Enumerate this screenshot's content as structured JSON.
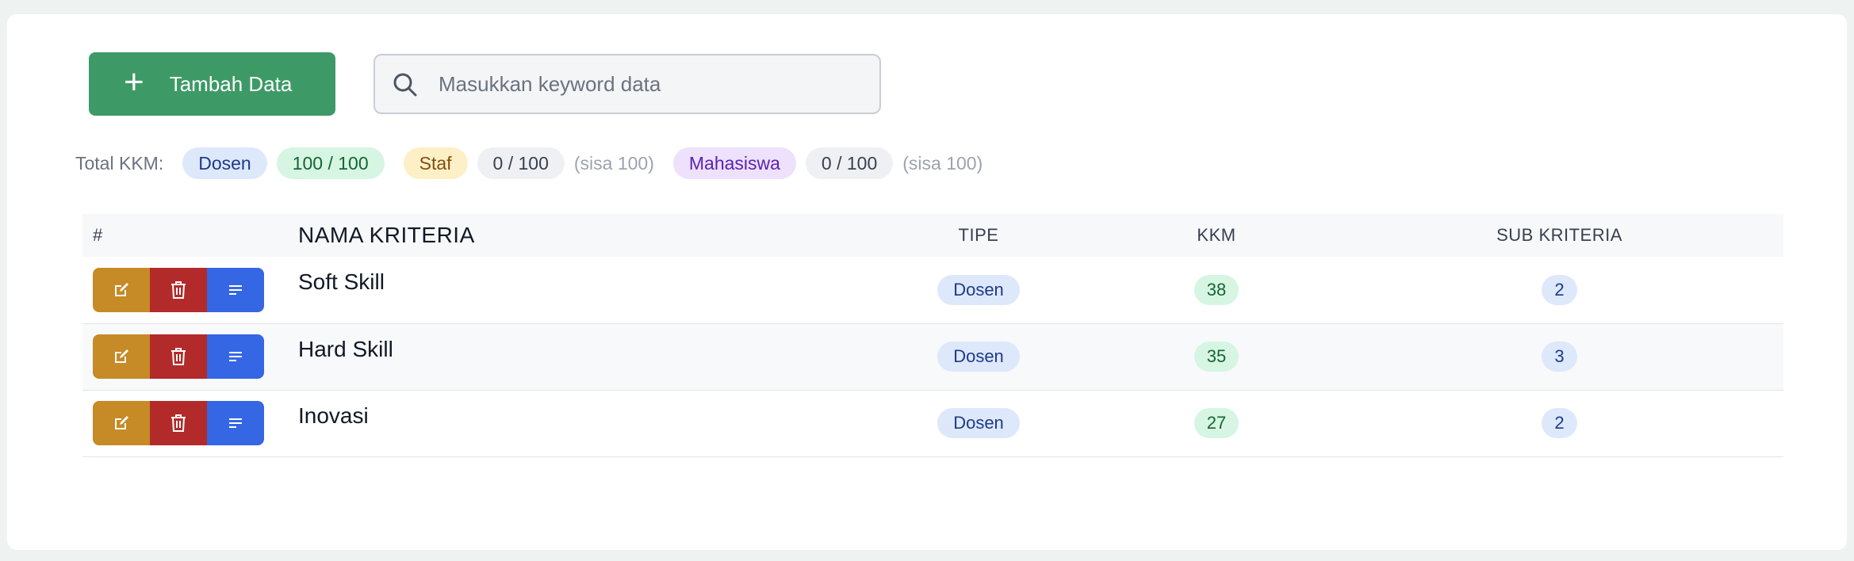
{
  "toolbar": {
    "add_label": "Tambah Data",
    "search_placeholder": "Masukkan keyword data"
  },
  "kkm_summary": {
    "label": "Total KKM:",
    "dosen": {
      "name": "Dosen",
      "value": "100 / 100"
    },
    "staf": {
      "name": "Staf",
      "value": "0 / 100",
      "sisa": "(sisa 100)"
    },
    "mahasiswa": {
      "name": "Mahasiswa",
      "value": "0 / 100",
      "sisa": "(sisa 100)"
    }
  },
  "table": {
    "headers": [
      "#",
      "NAMA KRITERIA",
      "TIPE",
      "KKM",
      "SUB KRITERIA"
    ],
    "rows": [
      {
        "nama": "Soft Skill",
        "tipe": "Dosen",
        "kkm": "38",
        "sub": "2"
      },
      {
        "nama": "Hard Skill",
        "tipe": "Dosen",
        "kkm": "35",
        "sub": "3"
      },
      {
        "nama": "Inovasi",
        "tipe": "Dosen",
        "kkm": "27",
        "sub": "2"
      }
    ]
  },
  "icons": {
    "add": "plus-icon",
    "search": "search-icon",
    "edit": "edit-icon",
    "delete": "trash-icon",
    "sub": "list-icon"
  },
  "colors": {
    "primary": "#3d9a66",
    "edit": "#c68a26",
    "delete": "#b32a2a",
    "sub": "#3566e4"
  }
}
